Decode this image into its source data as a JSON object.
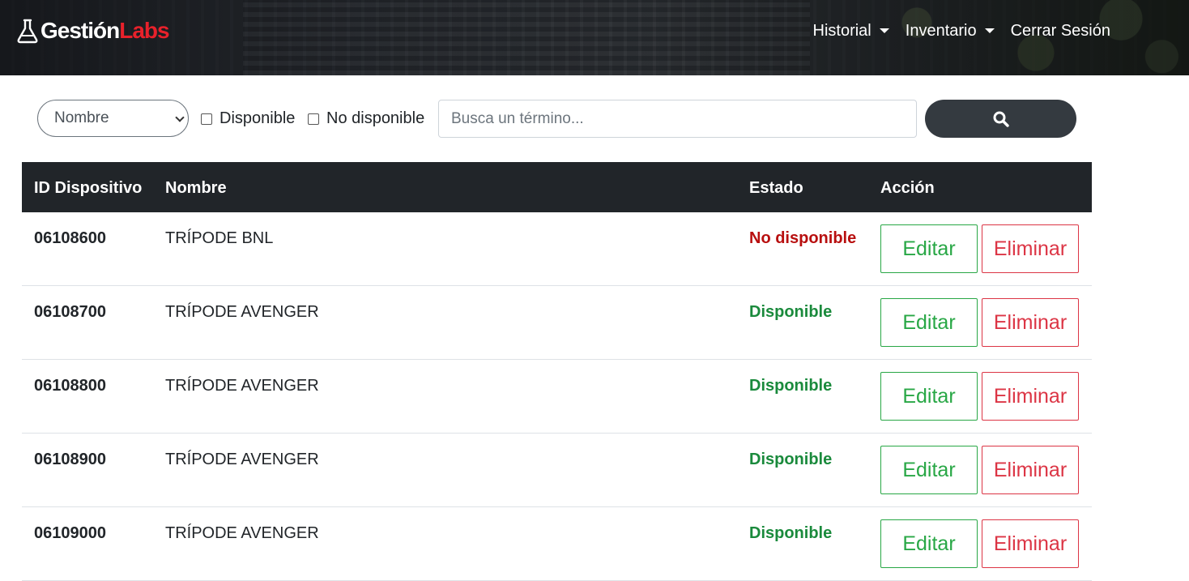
{
  "brand": {
    "part1": "Gestión",
    "part2": "Labs"
  },
  "nav": {
    "historial": "Historial",
    "inventario": "Inventario",
    "logout": "Cerrar Sesión"
  },
  "filters": {
    "select_value": "Nombre",
    "check_available": "Disponible",
    "check_unavailable": "No disponible",
    "search_placeholder": "Busca un término..."
  },
  "table": {
    "headers": {
      "id": "ID Dispositivo",
      "name": "Nombre",
      "status": "Estado",
      "action": "Acción"
    },
    "rows": [
      {
        "id": "06108600",
        "name": "TRÍPODE BNL",
        "status": "No disponible",
        "edit": "Editar",
        "delete": "Eliminar"
      },
      {
        "id": "06108700",
        "name": "TRÍPODE AVENGER",
        "status": "Disponible",
        "edit": "Editar",
        "delete": "Eliminar"
      },
      {
        "id": "06108800",
        "name": "TRÍPODE AVENGER",
        "status": "Disponible",
        "edit": "Editar",
        "delete": "Eliminar"
      },
      {
        "id": "06108900",
        "name": "TRÍPODE AVENGER",
        "status": "Disponible",
        "edit": "Editar",
        "delete": "Eliminar"
      },
      {
        "id": "06109000",
        "name": "TRÍPODE AVENGER",
        "status": "Disponible",
        "edit": "Editar",
        "delete": "Eliminar"
      }
    ]
  },
  "colors": {
    "brand_accent": "#e8212b",
    "available": "#1a8a3c",
    "unavailable": "#b80f0f",
    "edit": "#28a745",
    "delete": "#dc3545",
    "header_bg": "#212529"
  },
  "icons": {
    "brand": "flask-icon",
    "search": "search-icon"
  }
}
